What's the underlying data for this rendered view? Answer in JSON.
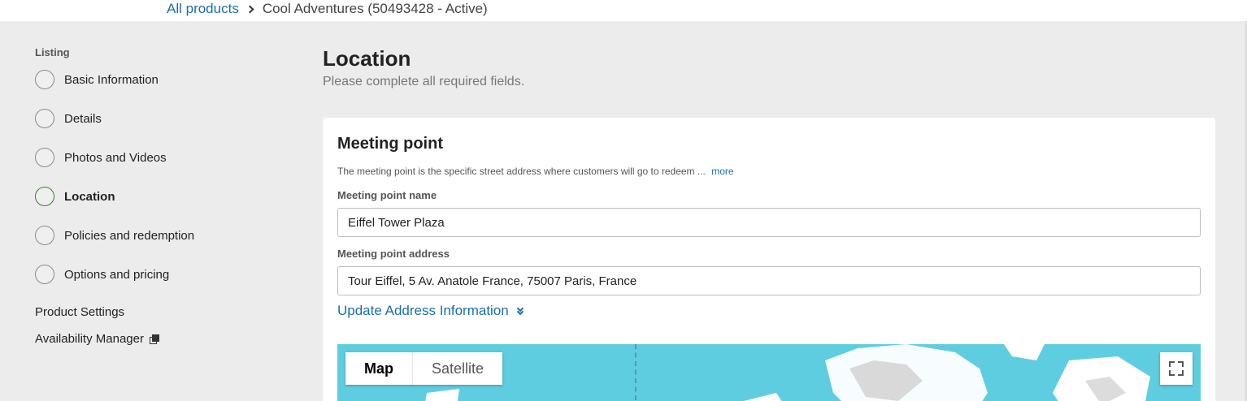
{
  "breadcrumb": {
    "root_label": "All products",
    "current_label": "Cool Adventures (50493428 - Active)"
  },
  "sidebar": {
    "heading": "Listing",
    "items": [
      {
        "label": "Basic Information",
        "active": false
      },
      {
        "label": "Details",
        "active": false
      },
      {
        "label": "Photos and Videos",
        "active": false
      },
      {
        "label": "Location",
        "active": true
      },
      {
        "label": "Policies and redemption",
        "active": false
      },
      {
        "label": "Options and pricing",
        "active": false
      }
    ],
    "product_settings": "Product Settings",
    "availability_manager": "Availability Manager"
  },
  "page": {
    "title": "Location",
    "subtitle": "Please complete all required fields."
  },
  "meeting_point": {
    "title": "Meeting point",
    "description": "The meeting point is the specific street address where customers will go to redeem ...",
    "more_label": "more",
    "name_label": "Meeting point name",
    "name_value": "Eiffel Tower Plaza",
    "address_label": "Meeting point address",
    "address_value": "Tour Eiffel, 5 Av. Anatole France, 75007 Paris, France",
    "update_label": "Update Address Information"
  },
  "map": {
    "map_label": "Map",
    "satellite_label": "Satellite",
    "selected": "Map"
  },
  "colors": {
    "link": "#1a6fb0",
    "active_circle": "#3a7d2a",
    "map_water": "#5fcde0",
    "background": "#ececec"
  }
}
